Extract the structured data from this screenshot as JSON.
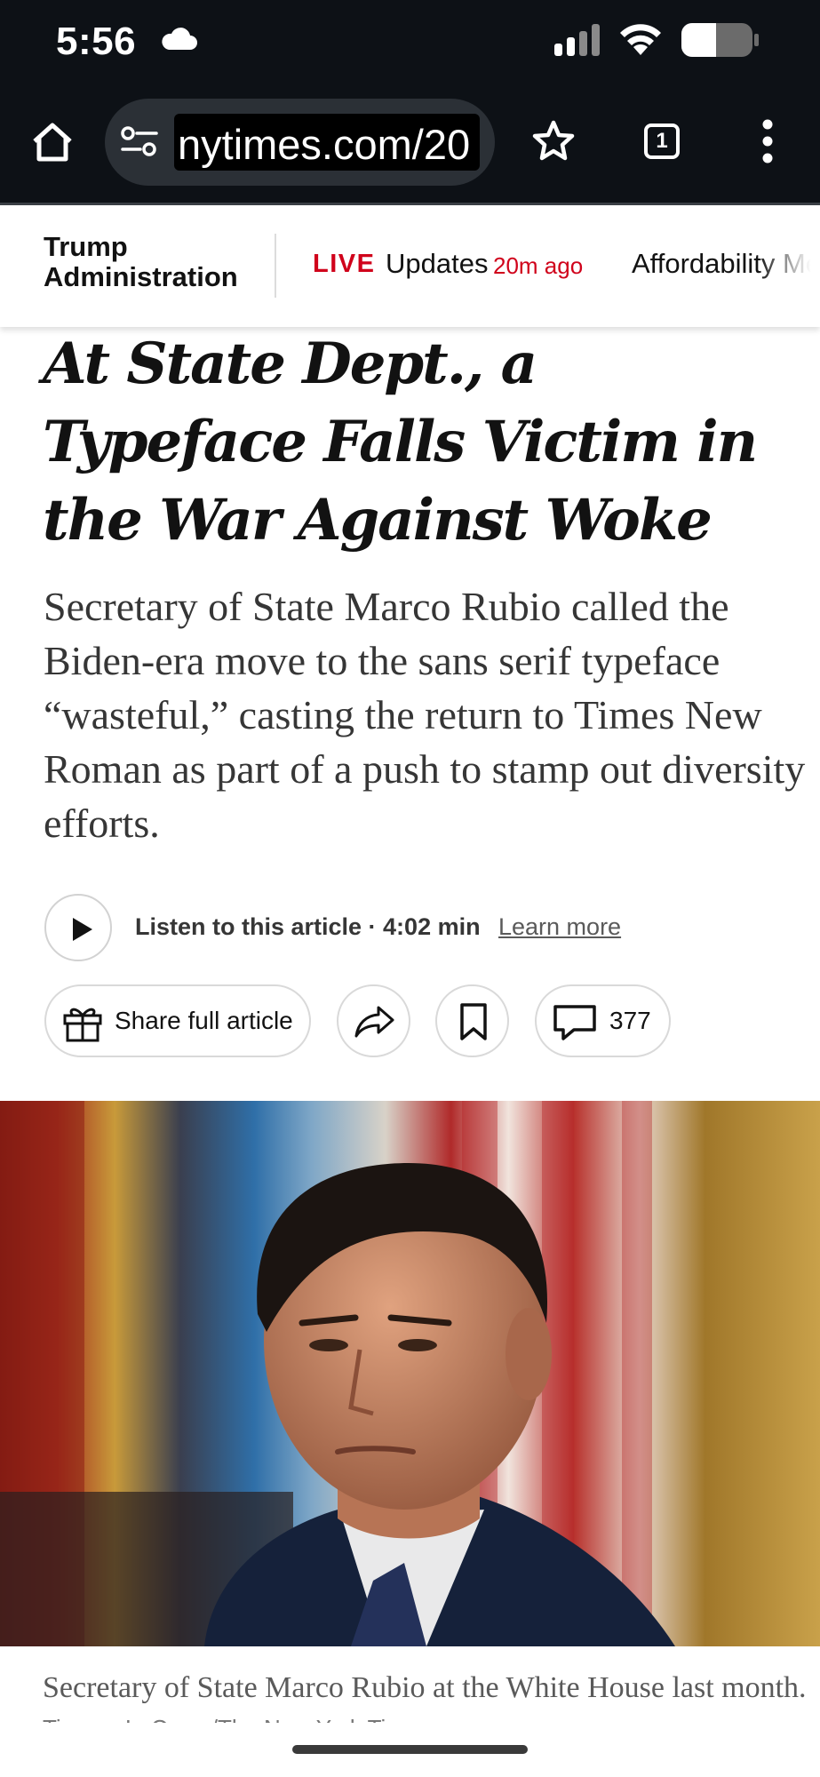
{
  "status_bar": {
    "time": "5:56",
    "icons": [
      "cloud-icon",
      "signal-icon",
      "wifi-icon",
      "battery-icon"
    ]
  },
  "browser": {
    "url": "nytimes.com/20",
    "tab_count": "1",
    "icons": [
      "home-icon",
      "site-settings-icon",
      "star-icon",
      "tabs-icon",
      "menu-icon"
    ]
  },
  "section_nav": {
    "section": "Trump Administration",
    "live": "LIVE",
    "updates": "Updates",
    "updated_ago": "20m ago",
    "next_link": "Affordability Me"
  },
  "article": {
    "headline": "At State Dept., a Typeface Falls Victim in the War Against Woke",
    "summary": "Secretary of State Marco Rubio called the Biden-era move to the sans serif typeface “wasteful,” casting the return to Times New Roman as part of a push to stamp out diversity efforts.",
    "listen_label": "Listen to this article · 4:02 min",
    "learn_more": "Learn more",
    "share_full": "Share full article",
    "comment_count": "377",
    "caption": "Secretary of State Marco Rubio at the White House last month.",
    "credit": "Tierney L. Cross/The New York Times"
  },
  "colors": {
    "live_red": "#d0021b",
    "browser_bg": "#0d1116",
    "text": "#121212"
  }
}
